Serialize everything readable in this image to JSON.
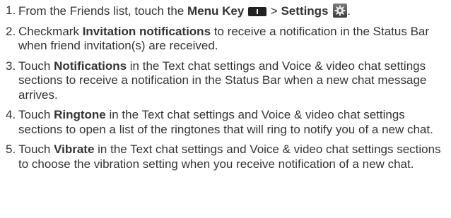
{
  "steps": [
    {
      "num": "1.",
      "p1": "From the Friends list, touch the ",
      "b1": "Menu Key",
      "p2": " > ",
      "b2": "Settings",
      "p3": "."
    },
    {
      "num": "2.",
      "p0": "Checkmark ",
      "b1": "Invitation notifications",
      "p1": " to receive a notification in the Status Bar when friend invitation(s) are received."
    },
    {
      "num": "3.",
      "p0": "Touch ",
      "b1": "Notifications",
      "p1": " in the Text chat settings and Voice & video chat settings sections to receive a notification in the Status Bar when a new chat message arrives."
    },
    {
      "num": "4.",
      "p0": "Touch ",
      "b1": "Ringtone",
      "p1": " in the Text chat settings and Voice & video chat settings sections to open a list of the ringtones that will ring to notify you of a new chat."
    },
    {
      "num": "5.",
      "p0": "Touch ",
      "b1": "Vibrate",
      "p1": " in the Text chat settings and Voice & video chat settings sections to choose the vibration setting when you receive notification of a new chat."
    }
  ],
  "icons": {
    "menu_key": "menu-key-icon",
    "settings": "gear-icon"
  }
}
